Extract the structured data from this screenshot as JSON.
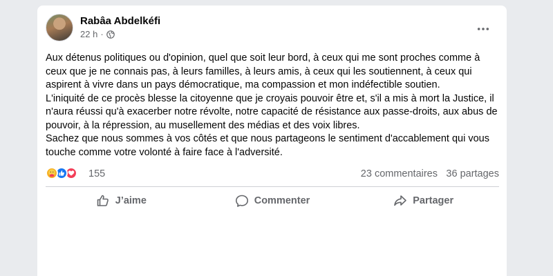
{
  "post": {
    "author": "Rabâa Abdelkéfi",
    "time": "22 h",
    "separator": "·",
    "body": [
      "Aux détenus politiques ou d'opinion, quel  que soit leur bord,  à ceux qui me sont proches comme à ceux que je ne connais pas, à leurs familles, à leurs amis, à ceux qui les soutiennent, à ceux qui aspirent à vivre dans un pays démocratique, ma compassion et mon indéfectible soutien.",
      "L'iniquité de ce procès blesse la citoyenne que je croyais pouvoir être et, s'il a mis à mort la  Justice, il n'aura réussi qu'à exacerber notre révolte, notre capacité de résistance aux passe-droits, aux abus de pouvoir, à la répression, au musellement des médias et des voix libres.",
      "Sachez que nous sommes à vos côtés et que nous partageons le sentiment d'accablement qui vous touche comme votre volonté à faire face à l'adversité."
    ]
  },
  "stats": {
    "reactions": "155",
    "comments": "23 commentaires",
    "shares": "36 partages"
  },
  "actions": {
    "like": "J’aime",
    "comment": "Commenter",
    "share": "Partager"
  },
  "icons": {
    "more": "more-options-icon",
    "privacy": "globe-icon",
    "reactions": [
      "care-reaction-icon",
      "like-reaction-icon",
      "love-reaction-icon"
    ]
  },
  "colors": {
    "like_blue": "#1877f2",
    "love_red": "#f33e58",
    "care_yellow": "#f7b125",
    "secondary_text": "#65676b"
  }
}
